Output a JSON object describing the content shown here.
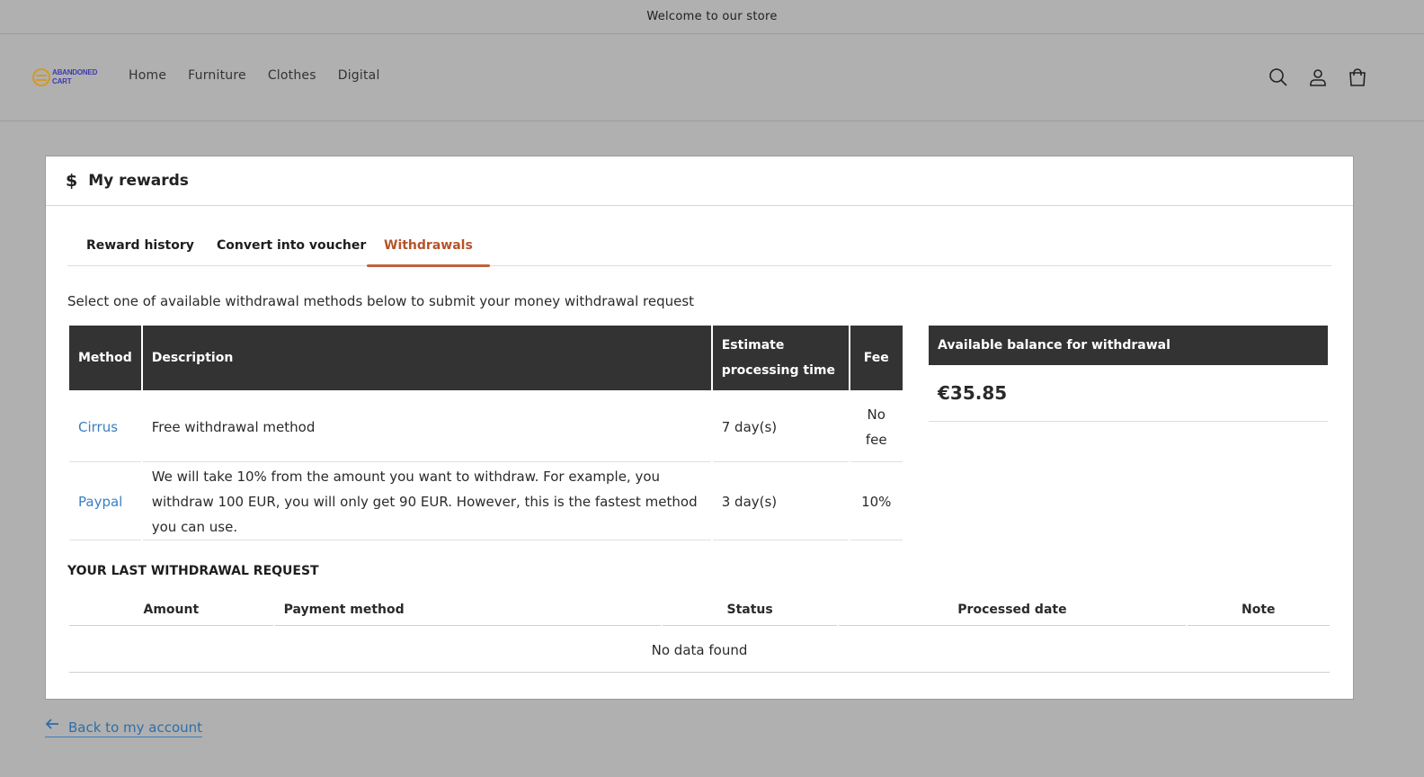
{
  "announcement": "Welcome to our store",
  "logo": {
    "line1": "ABANDONED",
    "line2": "CART"
  },
  "nav": [
    "Home",
    "Furniture",
    "Clothes",
    "Digital"
  ],
  "header_icons": [
    "search-icon",
    "account-icon",
    "cart-icon"
  ],
  "rewards": {
    "title": "My rewards",
    "icon": "$",
    "tabs": [
      "Reward history",
      "Convert into voucher",
      "Withdrawals"
    ],
    "active_tab": "Withdrawals",
    "intro": "Select one of available withdrawal methods below to submit your money withdrawal request",
    "methods_table": {
      "headers": [
        "Method",
        "Description",
        "Estimate processing time",
        "Fee"
      ],
      "rows": [
        {
          "method": "Cirrus",
          "description": "Free withdrawal method",
          "time": "7 day(s)",
          "fee": "No fee"
        },
        {
          "method": "Paypal",
          "description": "We will take 10% from the amount you want to withdraw. For example, you withdraw 100 EUR, you will only get 90 EUR. However, this is the fastest method you can use.",
          "time": "3 day(s)",
          "fee": "10%"
        }
      ]
    },
    "balance": {
      "label": "Available balance for withdrawal",
      "value": "€35.85"
    },
    "last_request": {
      "title": "YOUR LAST WITHDRAWAL REQUEST",
      "headers": [
        "Amount",
        "Payment method",
        "Status",
        "Processed date",
        "Note"
      ],
      "empty": "No data found"
    }
  },
  "back_link": "Back to my account",
  "colors": {
    "accent_tab": "#b5542b",
    "link": "#3a7fc1",
    "header_dark": "#333333",
    "overlay": "#b0b0b0"
  }
}
